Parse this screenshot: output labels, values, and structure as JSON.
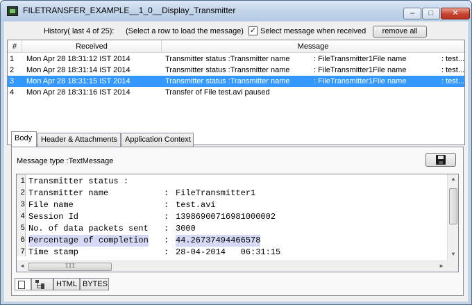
{
  "window": {
    "title": "FILETRANSFER_EXAMPLE__1_0__Display_Transmitter",
    "controls": {
      "minimize": "–",
      "maximize": "□",
      "close": "✕"
    }
  },
  "history": {
    "label": "History( last 4 of 25):",
    "hint": "(Select a row to load the message)",
    "checkbox_checked": true,
    "checkbox_mark": "✓",
    "checkbox_label": "Select message when received",
    "remove_all": "remove all"
  },
  "table": {
    "headers": {
      "num": "#",
      "received": "Received",
      "message": "Message"
    },
    "rows": [
      {
        "num": "1",
        "received": "Mon Apr 28 18:31:12 IST 2014",
        "message": "Transmitter status :Transmitter name",
        "file": ": FileTransmitter1File name",
        "extra": ": test...."
      },
      {
        "num": "2",
        "received": "Mon Apr 28 18:31:14 IST 2014",
        "message": "Transmitter status :Transmitter name",
        "file": ": FileTransmitter1File name",
        "extra": ": test...."
      },
      {
        "num": "3",
        "received": "Mon Apr 28 18:31:15 IST 2014",
        "message": "Transmitter status :Transmitter name",
        "file": ": FileTransmitter1File name",
        "extra": ": test...."
      },
      {
        "num": "4",
        "received": "Mon Apr 28 18:31:16 IST 2014",
        "message": "Transfer of File test.avi paused",
        "file": "",
        "extra": ""
      }
    ],
    "selected_row": "3"
  },
  "tabs": [
    "Body",
    "Header & Attachments",
    "Application Context"
  ],
  "active_tab": "Body",
  "body": {
    "message_type": "Message type :TextMessage",
    "lines": [
      {
        "num": "1",
        "key": "Transmitter status :",
        "colon": "",
        "value": ""
      },
      {
        "num": "2",
        "key": "Transmitter name",
        "colon": ":",
        "value": "FileTransmitter1"
      },
      {
        "num": "3",
        "key": "File name",
        "colon": ":",
        "value": "test.avi"
      },
      {
        "num": "4",
        "key": "Session Id",
        "colon": ":",
        "value": "13986900716981000002"
      },
      {
        "num": "5",
        "key": "No. of data packets sent",
        "colon": ":",
        "value": "3000"
      },
      {
        "num": "6",
        "key": "Percentage of completion",
        "colon": ":",
        "value": "44.26737494466578"
      },
      {
        "num": "7",
        "key": "Time stamp",
        "colon": ":",
        "value": "28-04-2014   06:31:15"
      }
    ],
    "scroll_thumb_grip": "III"
  },
  "bottom_tabs": {
    "html": "HTML",
    "bytes": "BYTES"
  },
  "colors": {
    "selection": "#3399ff",
    "highlight": "#d6d9f5"
  }
}
